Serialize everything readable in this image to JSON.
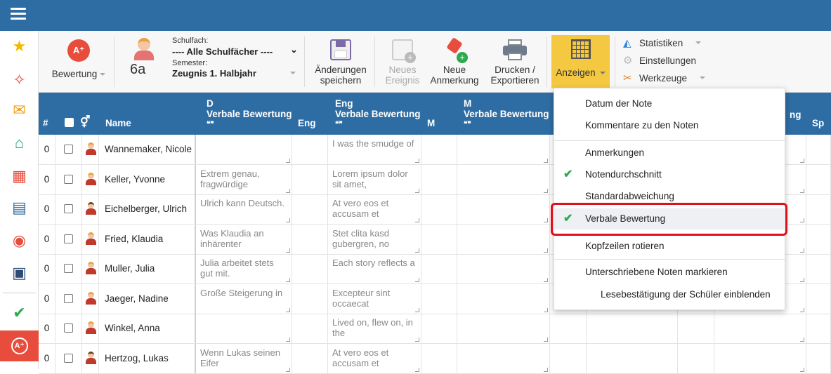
{
  "toolbar": {
    "bewertung_label": "Bewertung",
    "class_name": "6a",
    "schulfach_label": "Schulfach:",
    "schulfach_value": "---- Alle Schulfächer ----",
    "semester_label": "Semester:",
    "semester_value": "Zeugnis 1. Halbjahr",
    "save_label_1": "Änderungen",
    "save_label_2": "speichern",
    "new_event_1": "Neues",
    "new_event_2": "Ereignis",
    "new_note_1": "Neue",
    "new_note_2": "Anmerkung",
    "print_1": "Drucken /",
    "print_2": "Exportieren",
    "show_label": "Anzeigen",
    "statistiken": "Statistiken",
    "einstellungen": "Einstellungen",
    "werkzeuge": "Werkzeuge"
  },
  "header": {
    "hash": "#",
    "name": "Name",
    "d_subject": "D",
    "d_verbal": "Verbale Bewertung",
    "quote": "❝❞",
    "eng": "Eng",
    "eng_subject": "Eng",
    "eng_verbal": "Verbale Bewertung",
    "m": "M",
    "m_subject": "M",
    "m_verbal": "Verbale Bewertung",
    "ng": "ng",
    "sp": "Sp"
  },
  "rows": [
    {
      "num": "0",
      "name": "Wannemaker, Nicole",
      "d_text": "",
      "eng_text": "I was the smudge of",
      "gender": "f"
    },
    {
      "num": "0",
      "name": "Keller, Yvonne",
      "d_text": "Extrem genau, fragwürdige",
      "eng_text": "Lorem ipsum dolor sit amet,",
      "gender": "f"
    },
    {
      "num": "0",
      "name": "Eichelberger, Ulrich",
      "d_text": "Ulrich kann Deutsch.",
      "eng_text": "At vero eos et accusam et",
      "gender": "m"
    },
    {
      "num": "0",
      "name": "Fried, Klaudia",
      "d_text": "Was Klaudia an inhärenter",
      "eng_text": "Stet clita kasd gubergren, no",
      "gender": "f"
    },
    {
      "num": "0",
      "name": "Muller, Julia",
      "d_text": "Julia arbeitet stets gut mit.",
      "eng_text": "Each story reflects a",
      "gender": "f"
    },
    {
      "num": "0",
      "name": "Jaeger, Nadine",
      "d_text": "Große Steigerung in",
      "eng_text": "Excepteur sint occaecat",
      "gender": "f"
    },
    {
      "num": "0",
      "name": "Winkel, Anna",
      "d_text": "",
      "eng_text": "Lived on, flew on, in the",
      "gender": "f"
    },
    {
      "num": "0",
      "name": "Hertzog, Lukas",
      "d_text": "Wenn Lukas seinen Eifer",
      "eng_text": "At vero eos et accusam et",
      "gender": "m"
    }
  ],
  "dropdown": {
    "items": [
      {
        "label": "Datum der Note",
        "checked": false
      },
      {
        "label": "Kommentare zu den Noten",
        "checked": false
      },
      {
        "label": "Anmerkungen",
        "checked": false
      },
      {
        "label": "Notendurchschnitt",
        "checked": true
      },
      {
        "label": "Standardabweichung",
        "checked": false
      },
      {
        "label": "Verbale Bewertung",
        "checked": true
      },
      {
        "label": "Kopfzeilen rotieren",
        "checked": false
      },
      {
        "label": "Unterschriebene Noten markieren",
        "checked": false
      },
      {
        "label": "Lesebestätigung der Schüler einblenden",
        "checked": false
      }
    ]
  },
  "colors": {
    "header_blue": "#2e6da4",
    "accent_yellow": "#f5c842",
    "check_green": "#2fa84f",
    "highlight_red": "#e0101a"
  }
}
